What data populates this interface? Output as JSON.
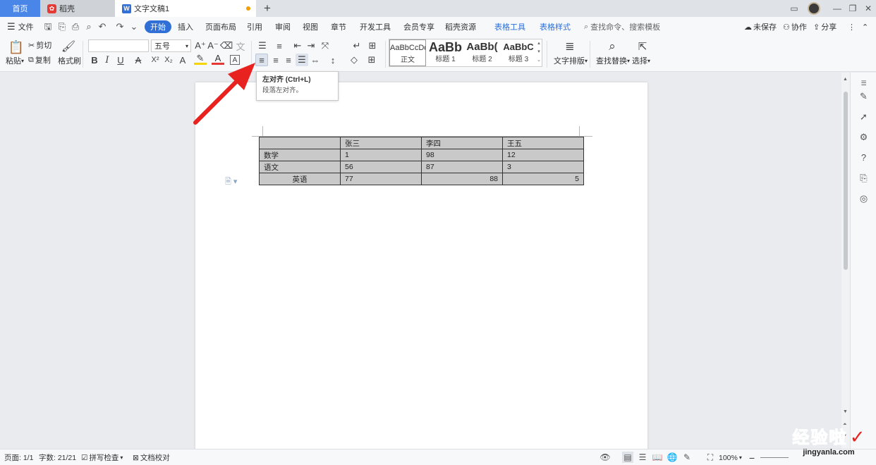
{
  "tabs": {
    "home": "首页",
    "daoke": "稻壳",
    "document": "文字文稿1",
    "daoke_icon": "daoke-logo-icon",
    "doc_icon": "wps-writer-icon"
  },
  "menu": {
    "file": "文件",
    "items": [
      "开始",
      "插入",
      "页面布局",
      "引用",
      "审阅",
      "视图",
      "章节",
      "开发工具",
      "会员专享",
      "稻壳资源"
    ],
    "context_tabs": [
      "表格工具",
      "表格样式"
    ],
    "search_placeholder": "查找命令、搜索模板",
    "unsaved": "未保存",
    "collaborate": "协作",
    "share": "分享"
  },
  "ribbon": {
    "paste": "粘贴",
    "cut": "剪切",
    "copy": "复制",
    "format_painter": "格式刷",
    "font_size": "五号",
    "styles": [
      {
        "sample": "AaBbCcDd",
        "label": "正文"
      },
      {
        "sample": "AaBb",
        "label": "标题 1"
      },
      {
        "sample": "AaBb(",
        "label": "标题 2"
      },
      {
        "sample": "AaBbC",
        "label": "标题 3"
      }
    ],
    "text_layout": "文字排版",
    "find_replace": "查找替换",
    "select": "选择"
  },
  "tooltip": {
    "title": "左对齐 (Ctrl+L)",
    "description": "段落左对齐。"
  },
  "table": {
    "rows": [
      [
        "",
        "张三",
        "李四",
        "王五"
      ],
      [
        "数学",
        "1",
        "98",
        "12"
      ],
      [
        "语文",
        "56",
        "87",
        "3"
      ],
      [
        "英语",
        "77",
        "88",
        "5"
      ]
    ]
  },
  "status": {
    "page": "页面: 1/1",
    "word_count": "字数: 21/21",
    "spell_check": "拼写检查",
    "proofread": "文档校对",
    "zoom": "100%"
  },
  "watermark": {
    "big": "经验啦",
    "small": "jingyanla.com",
    "check": "✓"
  },
  "colors": {
    "accent": "#2f6fd6",
    "arrow": "#e8231f",
    "table_fill": "#c9c9c9"
  }
}
